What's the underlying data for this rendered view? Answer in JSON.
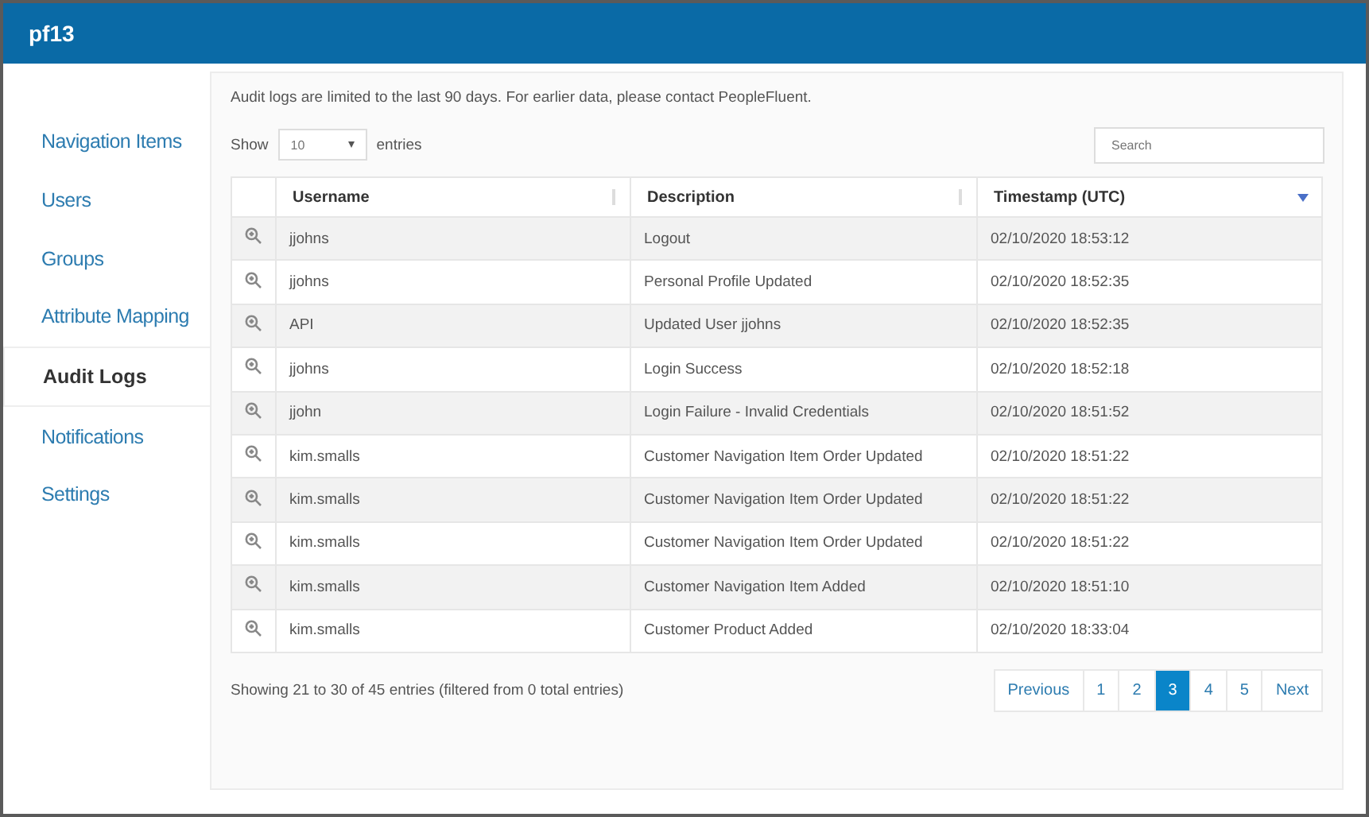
{
  "header": {
    "title": "pf13"
  },
  "sidebar": {
    "items": [
      {
        "label": "Navigation Items",
        "selected": false
      },
      {
        "label": "Users",
        "selected": false
      },
      {
        "label": "Groups",
        "selected": false
      },
      {
        "label": "Attribute Mapping",
        "selected": false
      },
      {
        "label": "Audit Logs",
        "selected": true
      },
      {
        "label": "Notifications",
        "selected": false
      },
      {
        "label": "Settings",
        "selected": false
      }
    ]
  },
  "notice": "Audit logs are limited to the last 90 days. For earlier data, please contact PeopleFluent.",
  "length_control": {
    "before": "Show",
    "value": "10",
    "after": "entries"
  },
  "search": {
    "placeholder": "Search"
  },
  "table": {
    "columns": [
      {
        "label": "Username",
        "kind": "sortable"
      },
      {
        "label": "Description",
        "kind": "sortable"
      },
      {
        "label": "Timestamp (UTC)",
        "kind": "descending"
      }
    ],
    "rows": [
      {
        "username": "jjohns",
        "description": "Logout",
        "timestamp": "02/10/2020 18:53:12"
      },
      {
        "username": "jjohns",
        "description": "Personal Profile Updated",
        "timestamp": "02/10/2020 18:52:35"
      },
      {
        "username": "API",
        "description": "Updated User jjohns",
        "timestamp": "02/10/2020 18:52:35"
      },
      {
        "username": "jjohns",
        "description": "Login Success",
        "timestamp": "02/10/2020 18:52:18"
      },
      {
        "username": "jjohn",
        "description": "Login Failure - Invalid Credentials",
        "timestamp": "02/10/2020 18:51:52"
      },
      {
        "username": "kim.smalls",
        "description": "Customer Navigation Item Order Updated",
        "timestamp": "02/10/2020 18:51:22"
      },
      {
        "username": "kim.smalls",
        "description": "Customer Navigation Item Order Updated",
        "timestamp": "02/10/2020 18:51:22"
      },
      {
        "username": "kim.smalls",
        "description": "Customer Navigation Item Order Updated",
        "timestamp": "02/10/2020 18:51:22"
      },
      {
        "username": "kim.smalls",
        "description": "Customer Navigation Item Added",
        "timestamp": "02/10/2020 18:51:10"
      },
      {
        "username": "kim.smalls",
        "description": "Customer Product Added",
        "timestamp": "02/10/2020 18:33:04"
      }
    ]
  },
  "info": "Showing 21 to 30 of 45 entries (filtered from 0 total entries)",
  "pagination": [
    {
      "label": "Previous",
      "selected": false
    },
    {
      "label": "1",
      "selected": false
    },
    {
      "label": "2",
      "selected": false
    },
    {
      "label": "3",
      "selected": true
    },
    {
      "label": "4",
      "selected": false
    },
    {
      "label": "5",
      "selected": false
    },
    {
      "label": "Next",
      "selected": false
    }
  ]
}
